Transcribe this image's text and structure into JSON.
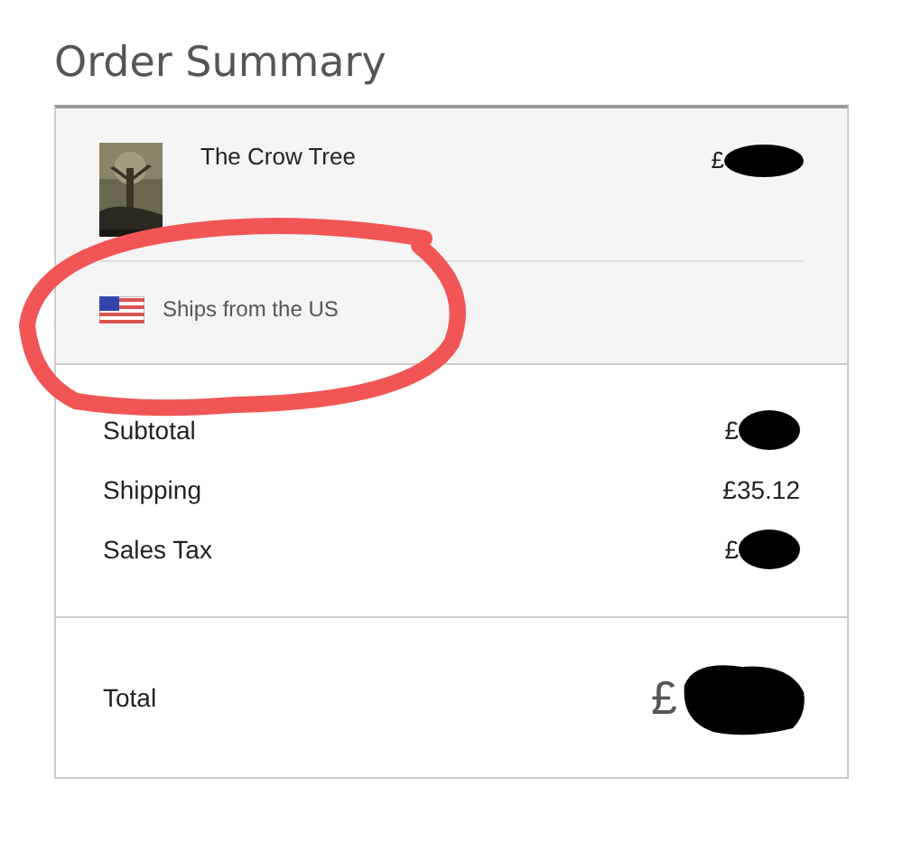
{
  "title": "Order Summary",
  "item": {
    "name": "The Crow Tree",
    "price": "£",
    "ships_from": "Ships from the US"
  },
  "totals": [
    {
      "label": "Subtotal",
      "value": "£",
      "redacted": true
    },
    {
      "label": "Shipping",
      "value": "£35.12",
      "redacted": false
    },
    {
      "label": "Sales Tax",
      "value": "£",
      "redacted": true
    }
  ],
  "total": {
    "label": "Total",
    "value": "£"
  }
}
